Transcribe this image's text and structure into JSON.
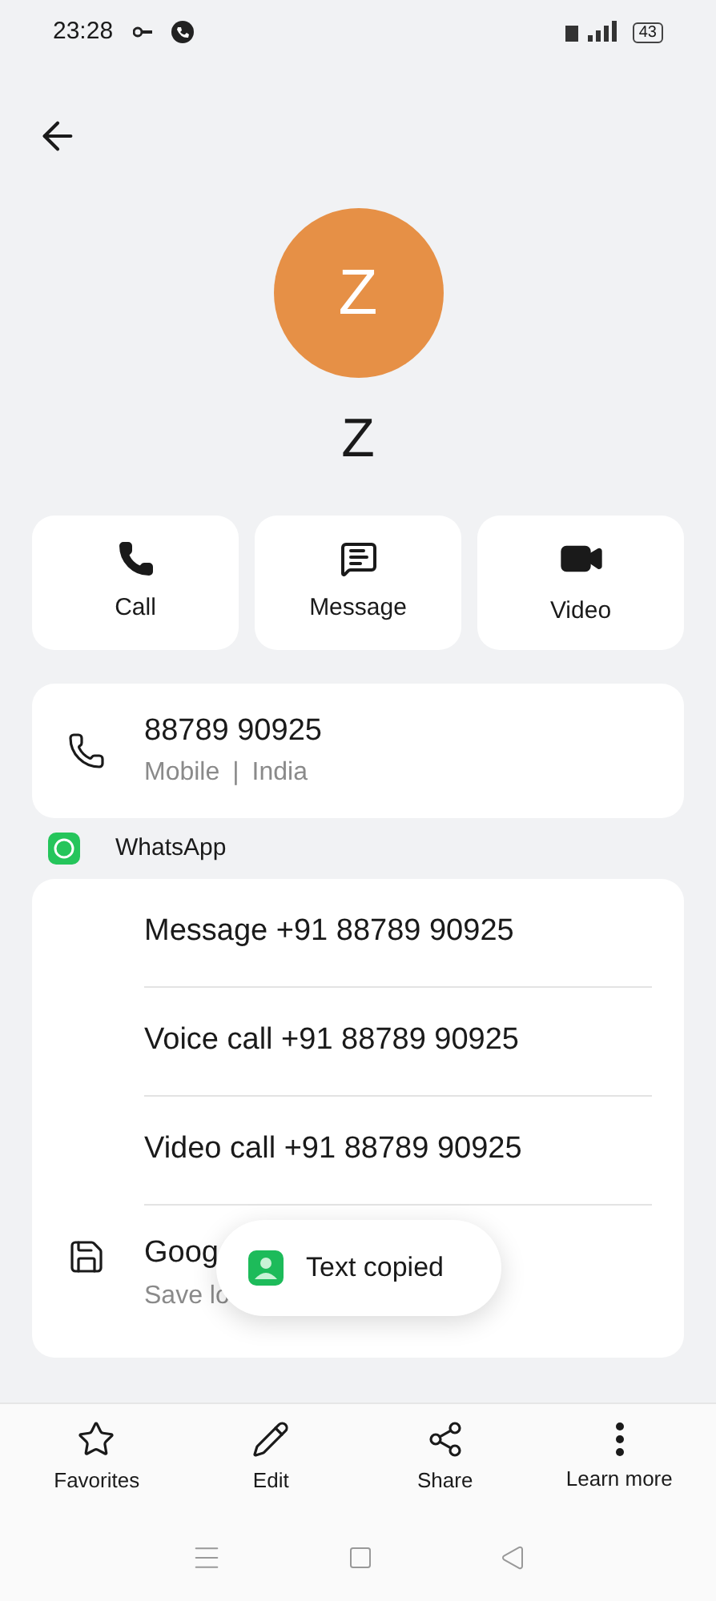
{
  "status_bar": {
    "time": "23:28",
    "battery": "43"
  },
  "contact": {
    "initial": "Z",
    "name": "Z"
  },
  "actions": [
    {
      "kind": "call",
      "label": "Call"
    },
    {
      "kind": "message",
      "label": "Message"
    },
    {
      "kind": "video",
      "label": "Video"
    }
  ],
  "phone": {
    "number": "88789 90925",
    "type": "Mobile",
    "separator": "|",
    "country": "India"
  },
  "whatsapp": {
    "label": "WhatsApp",
    "items": [
      "Message +91 88789 90925",
      "Voice call +91 88789 90925",
      "Video call +91 88789 90925"
    ]
  },
  "save": {
    "title": "Goog",
    "subtitle": "Save lo"
  },
  "toast": {
    "text": "Text copied"
  },
  "bottom_bar": [
    {
      "kind": "star",
      "label": "Favorites"
    },
    {
      "kind": "edit",
      "label": "Edit"
    },
    {
      "kind": "share",
      "label": "Share"
    },
    {
      "kind": "more",
      "label": "Learn more"
    }
  ]
}
